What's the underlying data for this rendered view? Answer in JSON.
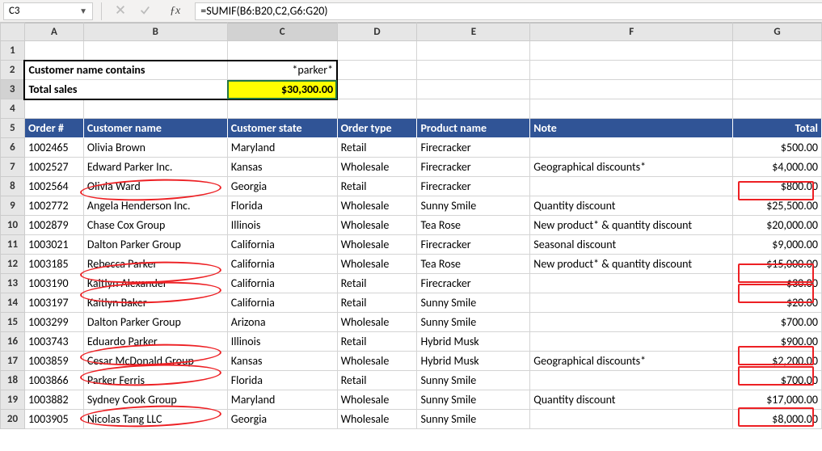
{
  "name_box": "C3",
  "formula": "=SUMIF(B6:B20,C2,G6:G20)",
  "col_labels": [
    "A",
    "B",
    "C",
    "D",
    "E",
    "F",
    "G"
  ],
  "row_labels": [
    "1",
    "2",
    "3",
    "4",
    "5",
    "6",
    "7",
    "8",
    "9",
    "10",
    "11",
    "12",
    "13",
    "14",
    "15",
    "16",
    "17",
    "18",
    "19",
    "20"
  ],
  "summary": {
    "label_contains": "Customer name contains",
    "contains_value": "*parker*",
    "label_total": "Total sales",
    "total_value": "$30,300.00"
  },
  "headers": {
    "order": "Order #",
    "customer": "Customer name",
    "state": "Customer state",
    "type": "Order type",
    "product": "Product name",
    "note": "Note",
    "total": "Total"
  },
  "rows": [
    {
      "order": "1002465",
      "customer": "Olivia Brown",
      "state": "Maryland",
      "type": "Retail",
      "product": "Firecracker",
      "note": "",
      "total": "$500.00"
    },
    {
      "order": "1002527",
      "customer": "Edward Parker Inc.",
      "state": "Kansas",
      "type": "Wholesale",
      "product": "Firecracker",
      "note": "Geographical discounts*",
      "total": "$4,000.00"
    },
    {
      "order": "1002564",
      "customer": "Olivia Ward",
      "state": "Georgia",
      "type": "Retail",
      "product": "Firecracker",
      "note": "",
      "total": "$800.00"
    },
    {
      "order": "1002772",
      "customer": "Angela Henderson Inc.",
      "state": "Florida",
      "type": "Wholesale",
      "product": "Sunny Smile",
      "note": "Quantity discount",
      "total": "$25,500.00"
    },
    {
      "order": "1002879",
      "customer": "Chase Cox Group",
      "state": "Illinois",
      "type": "Wholesale",
      "product": "Tea Rose",
      "note": "New product* & quantity discount",
      "total": "$20,000.00"
    },
    {
      "order": "1003021",
      "customer": "Dalton Parker Group",
      "state": "California",
      "type": "Wholesale",
      "product": "Firecracker",
      "note": "Seasonal discount",
      "total": "$9,000.00"
    },
    {
      "order": "1003185",
      "customer": "Rebecca Parker",
      "state": "California",
      "type": "Wholesale",
      "product": "Tea Rose",
      "note": "New product* & quantity discount",
      "total": "$15,000.00"
    },
    {
      "order": "1003190",
      "customer": "Kaitlyn Alexander",
      "state": "California",
      "type": "Retail",
      "product": "Firecracker",
      "note": "",
      "total": "$30.00"
    },
    {
      "order": "1003197",
      "customer": "Kaitlyn Baker",
      "state": "California",
      "type": "Retail",
      "product": "Sunny Smile",
      "note": "",
      "total": "$20.00"
    },
    {
      "order": "1003299",
      "customer": "Dalton Parker Group",
      "state": "Arizona",
      "type": "Wholesale",
      "product": "Sunny Smile",
      "note": "",
      "total": "$700.00"
    },
    {
      "order": "1003743",
      "customer": "Eduardo Parker",
      "state": "Illinois",
      "type": "Retail",
      "product": "Hybrid Musk",
      "note": "",
      "total": "$900.00"
    },
    {
      "order": "1003859",
      "customer": "Cesar McDonald Group",
      "state": "Kansas",
      "type": "Wholesale",
      "product": "Hybrid Musk",
      "note": "Geographical discounts*",
      "total": "$2,200.00"
    },
    {
      "order": "1003866",
      "customer": "Parker Ferris",
      "state": "Florida",
      "type": "Retail",
      "product": "Sunny Smile",
      "note": "",
      "total": "$700.00"
    },
    {
      "order": "1003882",
      "customer": "Sydney Cook Group",
      "state": "Maryland",
      "type": "Wholesale",
      "product": "Sunny Smile",
      "note": "Quantity discount",
      "total": "$17,000.00"
    },
    {
      "order": "1003905",
      "customer": "Nicolas Tang LLC",
      "state": "Georgia",
      "type": "Wholesale",
      "product": "Sunny Smile",
      "note": "",
      "total": "$8,000.00"
    }
  ],
  "chart_data": {
    "type": "table",
    "title": "Orders with SUMIF total for customer names containing parker",
    "sumif_criteria": "*parker*",
    "sumif_result": 30300.0,
    "columns": [
      "Order #",
      "Customer name",
      "Customer state",
      "Order type",
      "Product name",
      "Note",
      "Total"
    ],
    "data": [
      [
        1002465,
        "Olivia Brown",
        "Maryland",
        "Retail",
        "Firecracker",
        "",
        500.0
      ],
      [
        1002527,
        "Edward Parker Inc.",
        "Kansas",
        "Wholesale",
        "Firecracker",
        "Geographical discounts*",
        4000.0
      ],
      [
        1002564,
        "Olivia Ward",
        "Georgia",
        "Retail",
        "Firecracker",
        "",
        800.0
      ],
      [
        1002772,
        "Angela Henderson Inc.",
        "Florida",
        "Wholesale",
        "Sunny Smile",
        "Quantity discount",
        25500.0
      ],
      [
        1002879,
        "Chase Cox Group",
        "Illinois",
        "Wholesale",
        "Tea Rose",
        "New product* & quantity discount",
        20000.0
      ],
      [
        1003021,
        "Dalton Parker Group",
        "California",
        "Wholesale",
        "Firecracker",
        "Seasonal discount",
        9000.0
      ],
      [
        1003185,
        "Rebecca Parker",
        "California",
        "Wholesale",
        "Tea Rose",
        "New product* & quantity discount",
        15000.0
      ],
      [
        1003190,
        "Kaitlyn Alexander",
        "California",
        "Retail",
        "Firecracker",
        "",
        30.0
      ],
      [
        1003197,
        "Kaitlyn Baker",
        "California",
        "Retail",
        "Sunny Smile",
        "",
        20.0
      ],
      [
        1003299,
        "Dalton Parker Group",
        "Arizona",
        "Wholesale",
        "Sunny Smile",
        "",
        700.0
      ],
      [
        1003743,
        "Eduardo Parker",
        "Illinois",
        "Retail",
        "Hybrid Musk",
        "",
        900.0
      ],
      [
        1003859,
        "Cesar McDonald Group",
        "Kansas",
        "Wholesale",
        "Hybrid Musk",
        "Geographical discounts*",
        2200.0
      ],
      [
        1003866,
        "Parker Ferris",
        "Florida",
        "Retail",
        "Sunny Smile",
        "",
        700.0
      ],
      [
        1003882,
        "Sydney Cook Group",
        "Maryland",
        "Wholesale",
        "Sunny Smile",
        "Quantity discount",
        17000.0
      ],
      [
        1003905,
        "Nicolas Tang LLC",
        "Georgia",
        "Wholesale",
        "Sunny Smile",
        "",
        8000.0
      ]
    ]
  }
}
